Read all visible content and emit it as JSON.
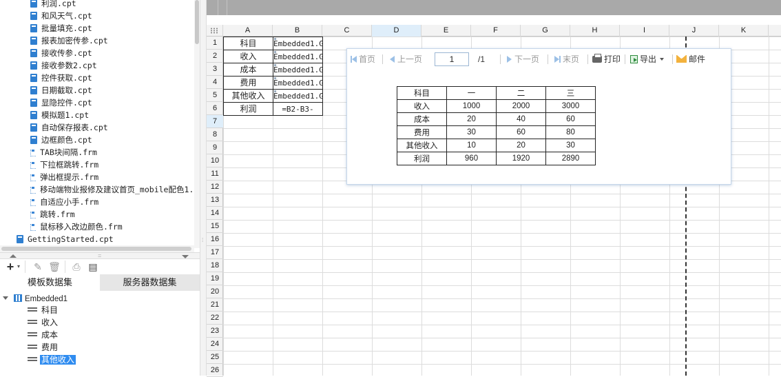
{
  "file_tree": {
    "items": [
      {
        "label": "利润.cpt",
        "type": "cpt"
      },
      {
        "label": "和风天气.cpt",
        "type": "cpt"
      },
      {
        "label": "批量填充.cpt",
        "type": "cpt"
      },
      {
        "label": "报表加密传参.cpt",
        "type": "cpt"
      },
      {
        "label": "接收传参.cpt",
        "type": "cpt"
      },
      {
        "label": "接收参数2.cpt",
        "type": "cpt"
      },
      {
        "label": "控件获取.cpt",
        "type": "cpt"
      },
      {
        "label": "日期截取.cpt",
        "type": "cpt"
      },
      {
        "label": "显隐控件.cpt",
        "type": "cpt"
      },
      {
        "label": "模拟题1.cpt",
        "type": "cpt"
      },
      {
        "label": "自动保存报表.cpt",
        "type": "cpt"
      },
      {
        "label": "边框颜色.cpt",
        "type": "cpt"
      },
      {
        "label": "TAB块间隔.frm",
        "type": "frm"
      },
      {
        "label": "下拉框跳转.frm",
        "type": "frm"
      },
      {
        "label": "弹出框提示.frm",
        "type": "frm"
      },
      {
        "label": "移动端物业报修及建议首页_mobile配色1.",
        "type": "frm"
      },
      {
        "label": "自适应小手.frm",
        "type": "frm"
      },
      {
        "label": "跳转.frm",
        "type": "frm"
      },
      {
        "label": "鼠标移入改边颜色.frm",
        "type": "frm"
      },
      {
        "label": "GettingStarted.cpt",
        "type": "cpt"
      }
    ]
  },
  "dataset_toolbar": {
    "add_icon": "plus-icon",
    "edit_icon": "pencil-icon",
    "delete_icon": "trash-icon",
    "preview_icon": "preview-icon",
    "properties_icon": "properties-icon"
  },
  "dataset_tabs": {
    "template": "模板数据集",
    "server": "服务器数据集"
  },
  "dataset_tree": {
    "root": "Embedded1",
    "fields": [
      "科目",
      "收入",
      "成本",
      "费用",
      "其他收入"
    ],
    "selected_field": "其他收入"
  },
  "sheet": {
    "columns": [
      "A",
      "B",
      "C",
      "D",
      "E",
      "F",
      "G",
      "H",
      "I",
      "J",
      "K"
    ],
    "selected_column": "D",
    "rows": [
      "1",
      "2",
      "3",
      "4",
      "5",
      "6",
      "7",
      "8",
      "9",
      "10",
      "11",
      "12",
      "13",
      "14",
      "15",
      "16",
      "17",
      "18",
      "19",
      "20",
      "21",
      "22",
      "23",
      "24",
      "25",
      "26"
    ],
    "selected_row": "7",
    "cells": {
      "A": [
        "科目",
        "收入",
        "成本",
        "费用",
        "其他收入",
        "利润"
      ],
      "B": [
        "Embedded1.G",
        "Embedded1.G",
        "Embedded1.G",
        "Embedded1.G",
        "Embedded1.G",
        "=B2-B3-"
      ]
    }
  },
  "preview": {
    "first": "首页",
    "prev": "上一页",
    "page_value": "1",
    "page_total": "/1",
    "next": "下一页",
    "last": "末页",
    "print": "打印",
    "export": "导出",
    "mail": "邮件",
    "table": [
      [
        "科目",
        "一",
        "二",
        "三"
      ],
      [
        "收入",
        "1000",
        "2000",
        "3000"
      ],
      [
        "成本",
        "20",
        "40",
        "60"
      ],
      [
        "费用",
        "30",
        "60",
        "80"
      ],
      [
        "其他收入",
        "10",
        "20",
        "30"
      ],
      [
        "利润",
        "960",
        "1920",
        "2890"
      ]
    ]
  },
  "colors": {
    "accent": "#2f8cf0",
    "selection_header": "#dfeefa",
    "toolbar_gray": "#a9a9a9"
  }
}
